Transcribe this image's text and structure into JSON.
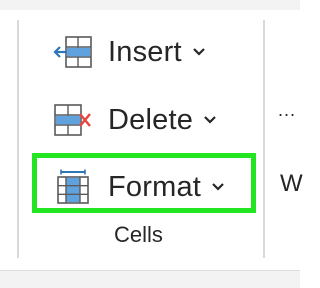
{
  "ribbon": {
    "cells_group": {
      "label": "Cells",
      "commands": [
        {
          "label": "Insert",
          "icon": "insert-cells-icon"
        },
        {
          "label": "Delete",
          "icon": "delete-cells-icon"
        },
        {
          "label": "Format",
          "icon": "format-cells-icon",
          "highlighted": true
        }
      ]
    },
    "next_group": {
      "overflow_text": "...",
      "partial_letter": "W"
    }
  },
  "colors": {
    "highlight": "#23e522",
    "icon_blue": "#2e75b6",
    "delete_x": "#e8453c",
    "text": "#262626"
  }
}
